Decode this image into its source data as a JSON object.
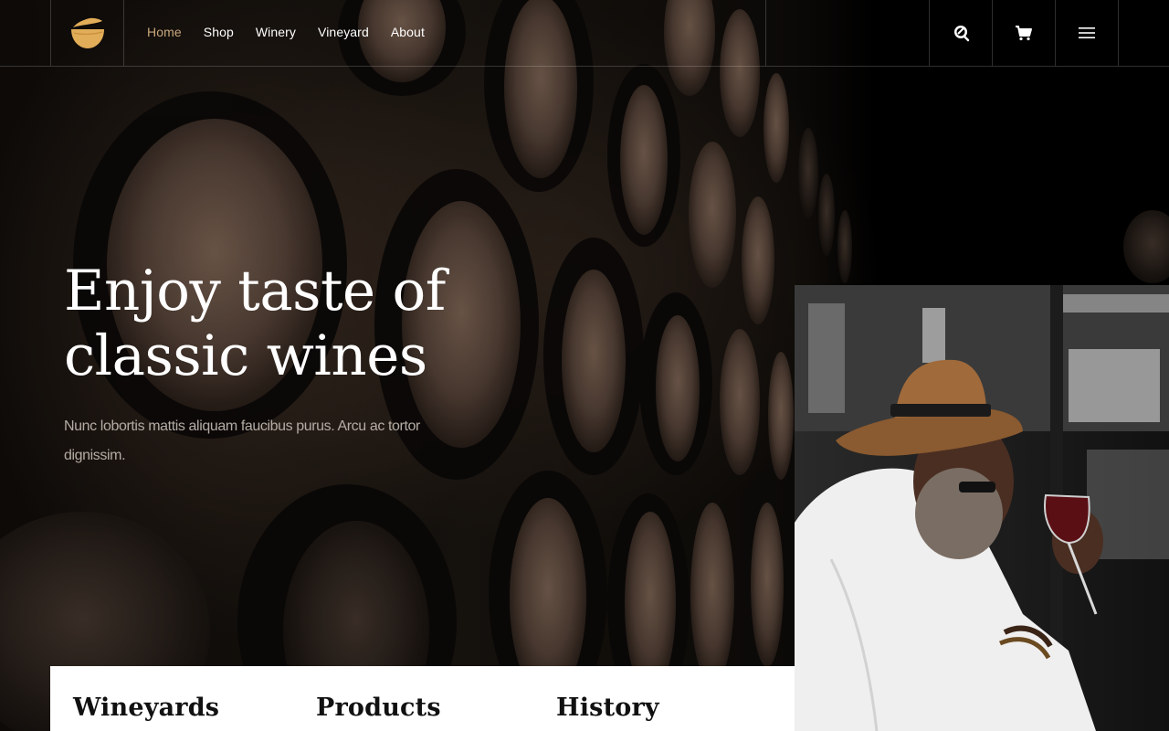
{
  "header": {
    "logo_name": "cup-logo-icon",
    "nav": [
      {
        "label": "Home",
        "active": true
      },
      {
        "label": "Shop",
        "active": false
      },
      {
        "label": "Winery",
        "active": false
      },
      {
        "label": "Vineyard",
        "active": false
      },
      {
        "label": "About",
        "active": false
      }
    ],
    "icons": [
      "search-icon",
      "cart-icon",
      "menu-icon"
    ]
  },
  "hero": {
    "headline_line1": "Enjoy taste of",
    "headline_line2": "classic wines",
    "subtext": "Nunc lobortis mattis aliquam faucibus purus. Arcu ac tortor dignissim."
  },
  "features": {
    "items": [
      {
        "title": "Wineyards"
      },
      {
        "title": "Products"
      },
      {
        "title": "History"
      }
    ]
  },
  "colors": {
    "accent": "#c9a77c",
    "logo_gold": "#e2ad58",
    "background": "#000000",
    "card": "#ffffff"
  }
}
